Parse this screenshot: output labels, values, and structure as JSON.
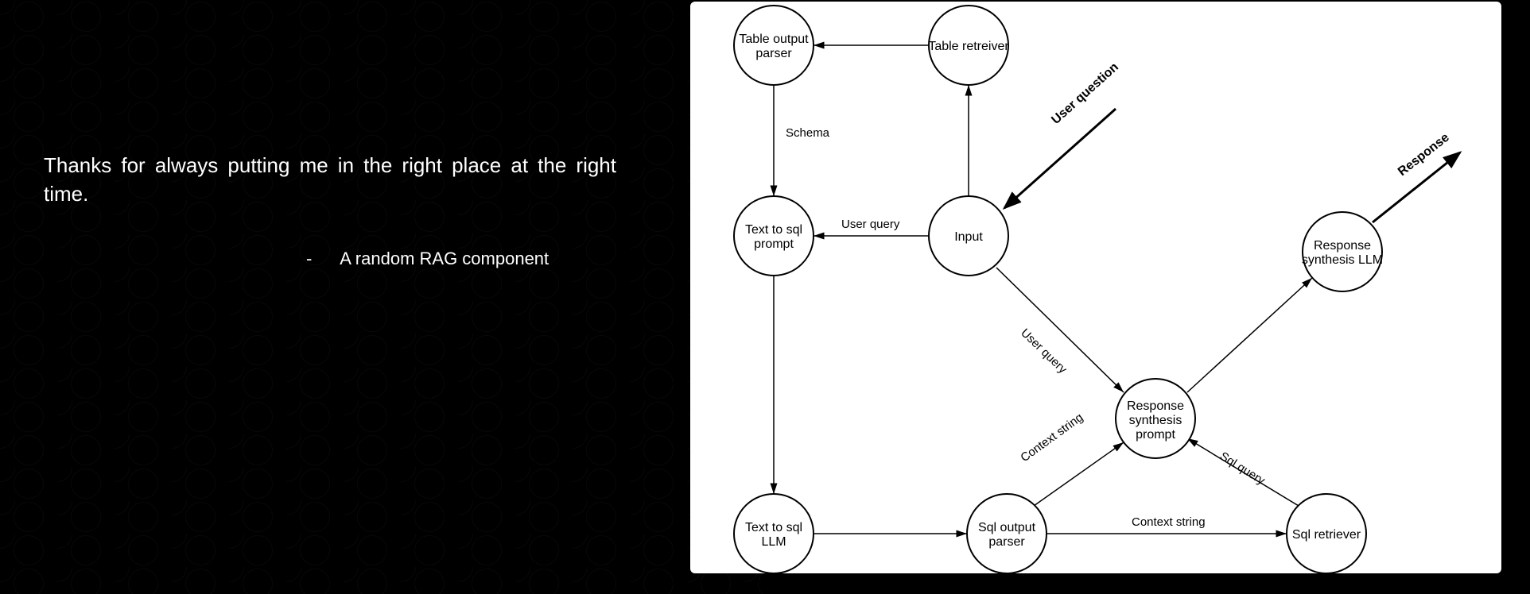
{
  "quote": {
    "text": "Thanks for always putting me in the right place at the right time.",
    "dash": "-",
    "attribution": "A random RAG component"
  },
  "diagram": {
    "nodes": {
      "table_output_parser": {
        "line1": "Table output",
        "line2": "parser"
      },
      "table_retriever": {
        "line1": "Table retreiver"
      },
      "text_to_sql_prompt": {
        "line1": "Text to sql",
        "line2": "prompt"
      },
      "input": {
        "line1": "Input"
      },
      "response_synthesis_llm": {
        "line1": "Response",
        "line2": "synthesis LLM"
      },
      "response_synthesis_prompt": {
        "line1": "Response",
        "line2": "synthesis",
        "line3": "prompt"
      },
      "text_to_sql_llm": {
        "line1": "Text to sql",
        "line2": "LLM"
      },
      "sql_output_parser": {
        "line1": "Sql output",
        "line2": "parser"
      },
      "sql_retriever": {
        "line1": "Sql retriever"
      }
    },
    "edges": {
      "schema": "Schema",
      "user_query": "User query",
      "user_query2": "User query",
      "user_question": "User question",
      "response": "Response",
      "context_string": "Context string",
      "context_string2": "Context string",
      "sql_query": "Sql query"
    }
  }
}
